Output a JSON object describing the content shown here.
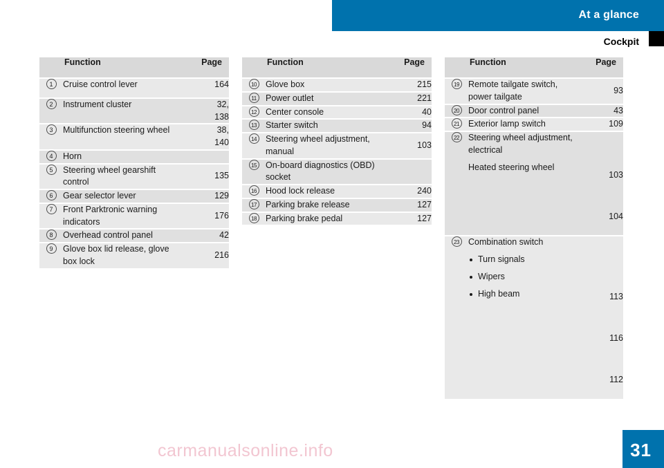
{
  "header": {
    "band_title": "At a glance",
    "section_title": "Cockpit"
  },
  "footer": {
    "page_number": "31",
    "watermark": "carmanualsonline.info"
  },
  "columns": [
    {
      "headers": {
        "function": "Function",
        "page": "Page"
      },
      "rows": [
        {
          "num": "1",
          "function": "Cruise control lever",
          "page": "164"
        },
        {
          "num": "2",
          "function": "Instrument cluster",
          "page": "32,\n138"
        },
        {
          "num": "3",
          "function": "Multifunction steering wheel",
          "page": "38,\n140"
        },
        {
          "num": "4",
          "function": "Horn",
          "page": ""
        },
        {
          "num": "5",
          "function": "Steering wheel gearshift control",
          "page": "135"
        },
        {
          "num": "6",
          "function": "Gear selector lever",
          "page": "129"
        },
        {
          "num": "7",
          "function": "Front Parktronic warning indicators",
          "page": "176"
        },
        {
          "num": "8",
          "function": "Overhead control panel",
          "page": "42"
        },
        {
          "num": "9",
          "function": "Glove box lid release, glove box lock",
          "page": "216"
        }
      ]
    },
    {
      "headers": {
        "function": "Function",
        "page": "Page"
      },
      "rows": [
        {
          "num": "10",
          "function": "Glove box",
          "page": "215"
        },
        {
          "num": "11",
          "function": "Power outlet",
          "page": "221"
        },
        {
          "num": "12",
          "function": "Center console",
          "page": "40"
        },
        {
          "num": "13",
          "function": "Starter switch",
          "page": "94"
        },
        {
          "num": "14",
          "function": "Steering wheel adjustment, manual",
          "page": "103"
        },
        {
          "num": "15",
          "function": "On-board diagnostics (OBD) socket",
          "page": ""
        },
        {
          "num": "16",
          "function": "Hood lock release",
          "page": "240"
        },
        {
          "num": "17",
          "function": "Parking brake release",
          "page": "127"
        },
        {
          "num": "18",
          "function": "Parking brake pedal",
          "page": "127"
        }
      ]
    },
    {
      "headers": {
        "function": "Function",
        "page": "Page"
      },
      "rows": [
        {
          "num": "19",
          "function": "Remote tailgate switch, power tailgate",
          "page": "93"
        },
        {
          "num": "20",
          "function": "Door control panel",
          "page": "43"
        },
        {
          "num": "21",
          "function": "Exterior lamp switch",
          "page": "109"
        },
        {
          "num": "22",
          "function": "Steering wheel adjustment, electrical",
          "page": "103",
          "function2": "Heated steering wheel",
          "page2": "104"
        },
        {
          "num": "23",
          "function": "Combination switch",
          "page": "",
          "subitems": [
            {
              "label": "Turn signals",
              "page": "113"
            },
            {
              "label": "Wipers",
              "page": "116"
            },
            {
              "label": "High beam",
              "page": "112"
            }
          ]
        }
      ]
    }
  ]
}
